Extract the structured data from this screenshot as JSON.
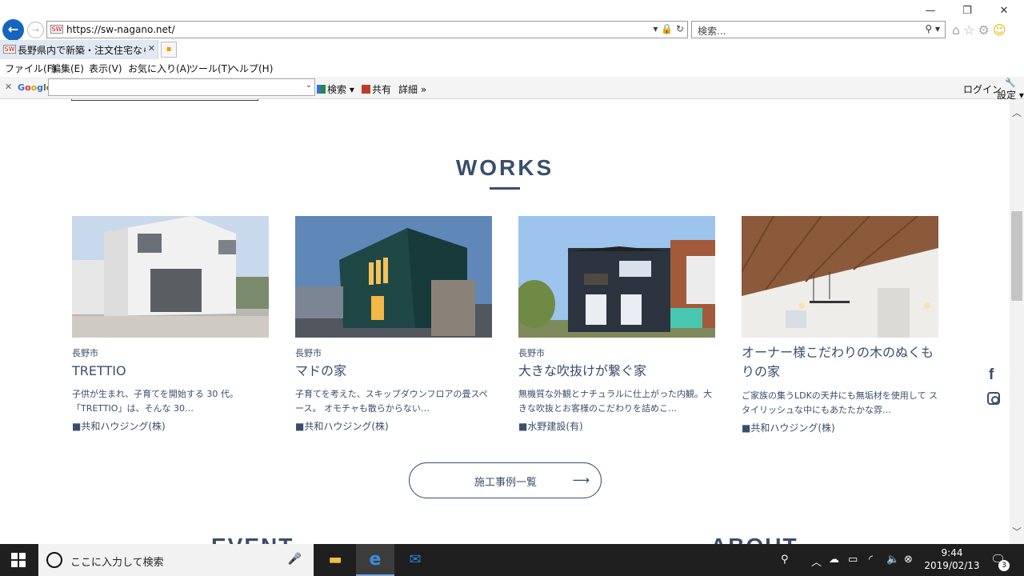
{
  "browser": {
    "url": "https://sw-nagano.net/",
    "search_placeholder": "検索...",
    "tab_title": "長野県内で新築・注文住宅なら...",
    "menu": [
      "ファイル(F)",
      "編集(E)",
      "表示(V)",
      "お気に入り(A)",
      "ツール(T)",
      "ヘルプ(H)"
    ],
    "google_bar": {
      "logo": "Google",
      "search_btn": "検索",
      "share_btn": "共有",
      "more_btn": "詳細",
      "login": "ログイン",
      "settings": "設定"
    }
  },
  "page": {
    "section_title": "WORKS",
    "cards": [
      {
        "area": "長野市",
        "title": "TRETTIO",
        "desc": "子供が生まれ、子育てを開始する 30 代。「TRETTIO」は、そんな 30…",
        "maker": "■共和ハウジング(株)"
      },
      {
        "area": "長野市",
        "title": "マドの家",
        "desc": "子育てを考えた、スキップダウンフロアの畳スペース。 オモチャも散らからない…",
        "maker": "■共和ハウジング(株)"
      },
      {
        "area": "長野市",
        "title": "大きな吹抜けが繋ぐ家",
        "desc": "無機質な外観とナチュラルに仕上がった内観。大きな吹抜とお客様のこだわりを詰めこ…",
        "maker": "■水野建設(有)"
      },
      {
        "area": "",
        "title": "オーナー様こだわりの木のぬくもりの家",
        "desc": "ご家族の集うLDKの天井にも無垢材を使用して スタイリッシュな中にもあたたかな雰…",
        "maker": "■共和ハウジング(株)"
      }
    ],
    "more_button": "施工事例一覧",
    "next_sections": [
      "EVENT",
      "ABOUT"
    ]
  },
  "taskbar": {
    "search_placeholder": "ここに入力して検索",
    "time": "9:44",
    "date": "2019/02/13",
    "notifications": "3"
  }
}
